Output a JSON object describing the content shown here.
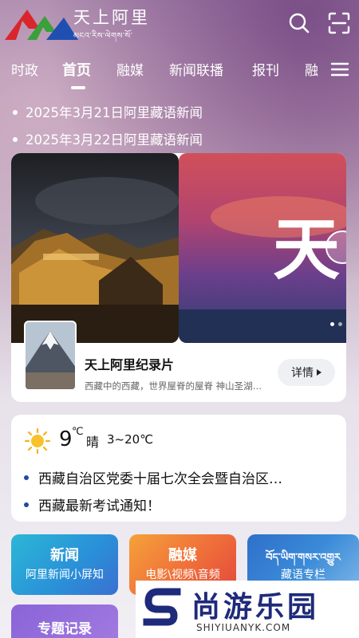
{
  "header": {
    "app_title": "天上阿里",
    "tibetan_subtitle": "མངའ་རིས་ལེགས་སོ་",
    "search_icon": "search-icon",
    "scan_icon": "scan-icon"
  },
  "tabs": [
    {
      "label": "时政"
    },
    {
      "label": "首页"
    },
    {
      "label": "融媒"
    },
    {
      "label": "新闻联播"
    },
    {
      "label": "报刊"
    },
    {
      "label": "融"
    }
  ],
  "active_tab": "首页",
  "notices": [
    "2025年3月21日阿里藏语新闻",
    "2025年3月22日阿里藏语新闻"
  ],
  "feature": {
    "slide_text": "天",
    "title": "天上阿里纪录片",
    "description": "西藏中的西藏，世界屋脊的屋脊 神山圣湖…",
    "detail_label": "详情"
  },
  "weather": {
    "temperature": "9",
    "unit": "℃",
    "condition": "晴",
    "range": "3~20℃"
  },
  "news": [
    "西藏自治区党委十届七次全会暨自治区…",
    "西藏最新考试通知！"
  ],
  "tiles": [
    {
      "title": "新闻",
      "subtitle": "阿里新闻小屏知"
    },
    {
      "title": "融媒",
      "subtitle": "电影\\视频\\音频"
    },
    {
      "title": "བོད་ཡིག་གསར་འགྱུར",
      "subtitle": "藏语专栏"
    }
  ],
  "tiles_row2": [
    {
      "title": "专题记录"
    }
  ],
  "watermark": {
    "cn": "尚游乐园",
    "en": "SHIYIUANYK.COM"
  },
  "colors": {
    "accent_blue": "#1f4b9e",
    "logo_red": "#d9262c",
    "logo_green": "#3aa03a",
    "logo_blue": "#1f4fb0"
  }
}
